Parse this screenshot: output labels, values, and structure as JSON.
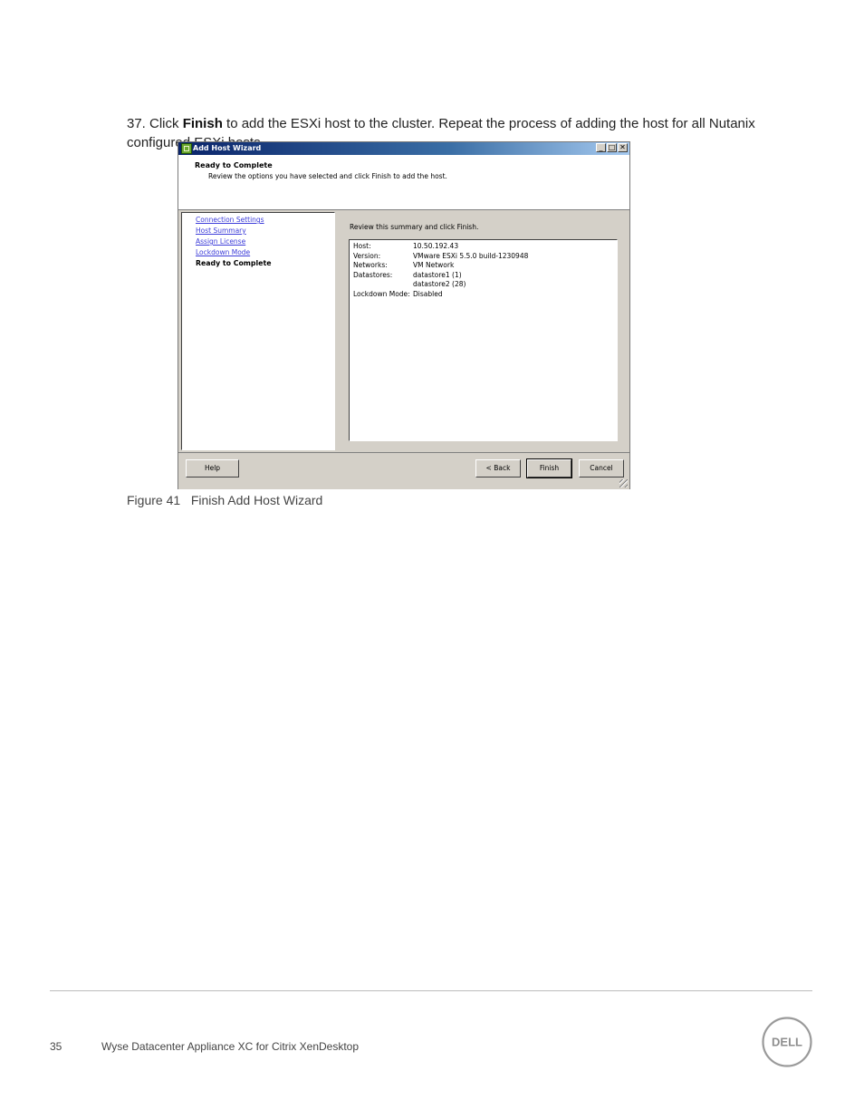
{
  "step": {
    "prefix": "37. Click ",
    "bold": "Finish",
    "rest": " to add the ESXi host to the cluster. Repeat the process of adding the host for all Nutanix configured ESXi hosts."
  },
  "dialog": {
    "title": "Add Host Wizard",
    "controls": {
      "minimize": "_",
      "maximize": "□",
      "close": "✕"
    },
    "header_title": "Ready to Complete",
    "header_subtitle": "Review the options you have selected and click Finish to add the host.",
    "nav": [
      "Connection Settings",
      "Host Summary",
      "Assign License",
      "Lockdown Mode",
      "Ready to Complete"
    ],
    "review_label": "Review this summary and click Finish.",
    "summary": [
      {
        "key": "Host:",
        "value": "10.50.192.43"
      },
      {
        "key": "Version:",
        "value": "VMware ESXi 5.5.0 build-1230948"
      },
      {
        "key": "Networks:",
        "value": "VM Network"
      },
      {
        "key": "Datastores:",
        "value": "datastore1 (1)"
      },
      {
        "key": "",
        "value": "datastore2 (28)"
      },
      {
        "key": "Lockdown Mode:",
        "value": "Disabled"
      }
    ],
    "buttons": {
      "help": "Help",
      "back": "< Back",
      "finish": "Finish",
      "cancel": "Cancel"
    }
  },
  "caption": "Figure 41   Finish Add Host Wizard",
  "footer": {
    "page_number": "35",
    "doc_title": "Wyse Datacenter Appliance XC for Citrix XenDesktop",
    "logo_text": "DELL"
  }
}
